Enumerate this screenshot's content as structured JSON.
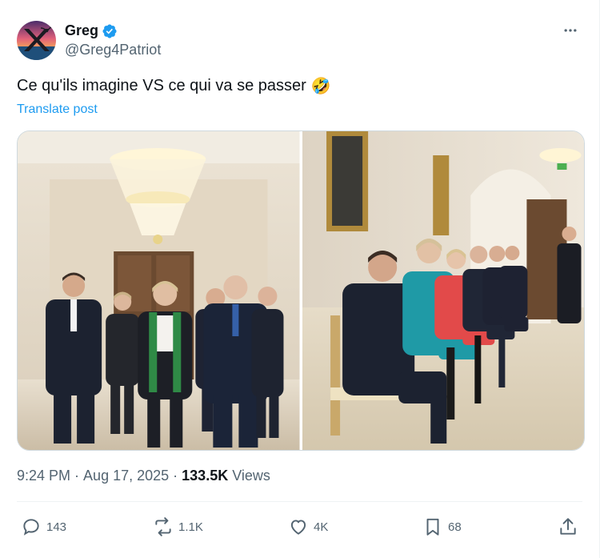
{
  "author": {
    "name": "Greg",
    "handle": "@Greg4Patriot",
    "verified": true,
    "avatar_icon": "x-logo-sunset-avatar"
  },
  "post": {
    "text": "Ce qu'ils imagine VS ce qui va se passer",
    "emoji": "🤣",
    "translate_label": "Translate post"
  },
  "media": {
    "images": [
      {
        "icon": "photo-leaders-walking-hallway"
      },
      {
        "icon": "photo-leaders-seated-waiting"
      }
    ]
  },
  "meta": {
    "time": "9:24 PM",
    "separator": "·",
    "date": "Aug 17, 2025",
    "views_count": "133.5K",
    "views_label": "Views"
  },
  "actions": {
    "replies": "143",
    "reposts": "1.1K",
    "likes": "4K",
    "bookmarks": "68"
  },
  "colors": {
    "accent": "#1d9bf0",
    "text_primary": "#0f1419",
    "text_secondary": "#536471",
    "border": "#cfd9de"
  }
}
